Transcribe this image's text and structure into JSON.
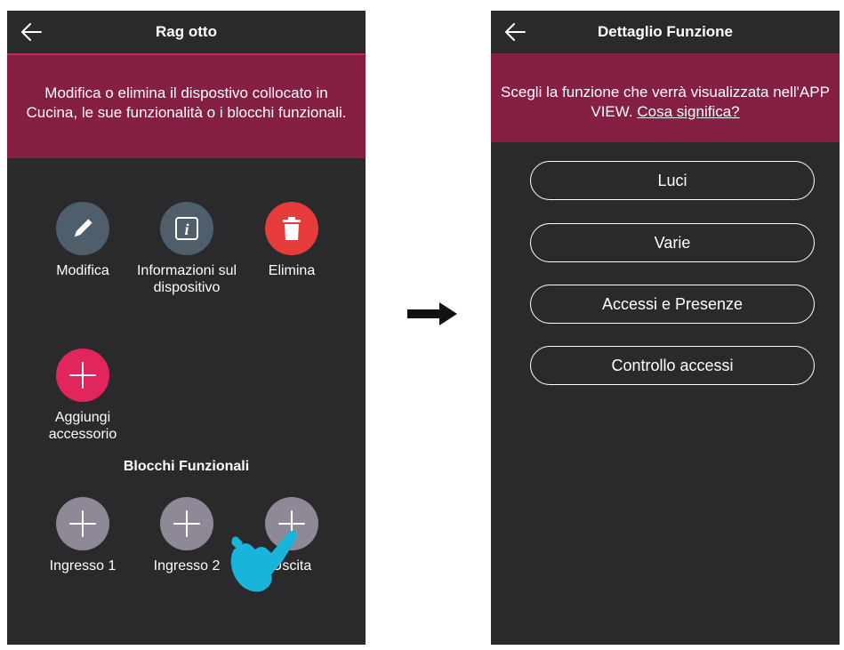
{
  "left_screen": {
    "title": "Rag otto",
    "banner_text": "Modifica o elimina il dispostivo collocato in Cucina, le sue funzionalità o i blocchi funzionali.",
    "actions": [
      {
        "label": "Modifica",
        "icon": "pencil-icon",
        "color": "#4f5e6b"
      },
      {
        "label": "Informazioni sul dispositivo",
        "icon": "info-icon",
        "color": "#4f5e6b"
      },
      {
        "label": "Elimina",
        "icon": "trash-icon",
        "color": "#e63c3c"
      }
    ],
    "add_accessory": {
      "label": "Aggiungi accessorio",
      "icon": "plus-icon",
      "color": "#e0265c"
    },
    "section_title": "Blocchi Funzionali",
    "blocks": [
      {
        "label": "Ingresso 1",
        "icon": "plus-icon"
      },
      {
        "label": "Ingresso 2",
        "icon": "plus-icon"
      },
      {
        "label": "Uscita",
        "icon": "plus-icon"
      }
    ]
  },
  "right_screen": {
    "title": "Dettaglio Funzione",
    "banner_text": "Scegli la funzione che verrà visualizzata nell'APP VIEW.",
    "banner_link": "Cosa significa?",
    "options": [
      "Luci",
      "Varie",
      "Accessi e Presenze",
      "Controllo accessi"
    ]
  },
  "colors": {
    "background": "#2a2a2c",
    "banner": "#861f44",
    "accent_pink": "#e0265c",
    "delete_red": "#e63c3c",
    "hand_cyan": "#18b4dc"
  }
}
